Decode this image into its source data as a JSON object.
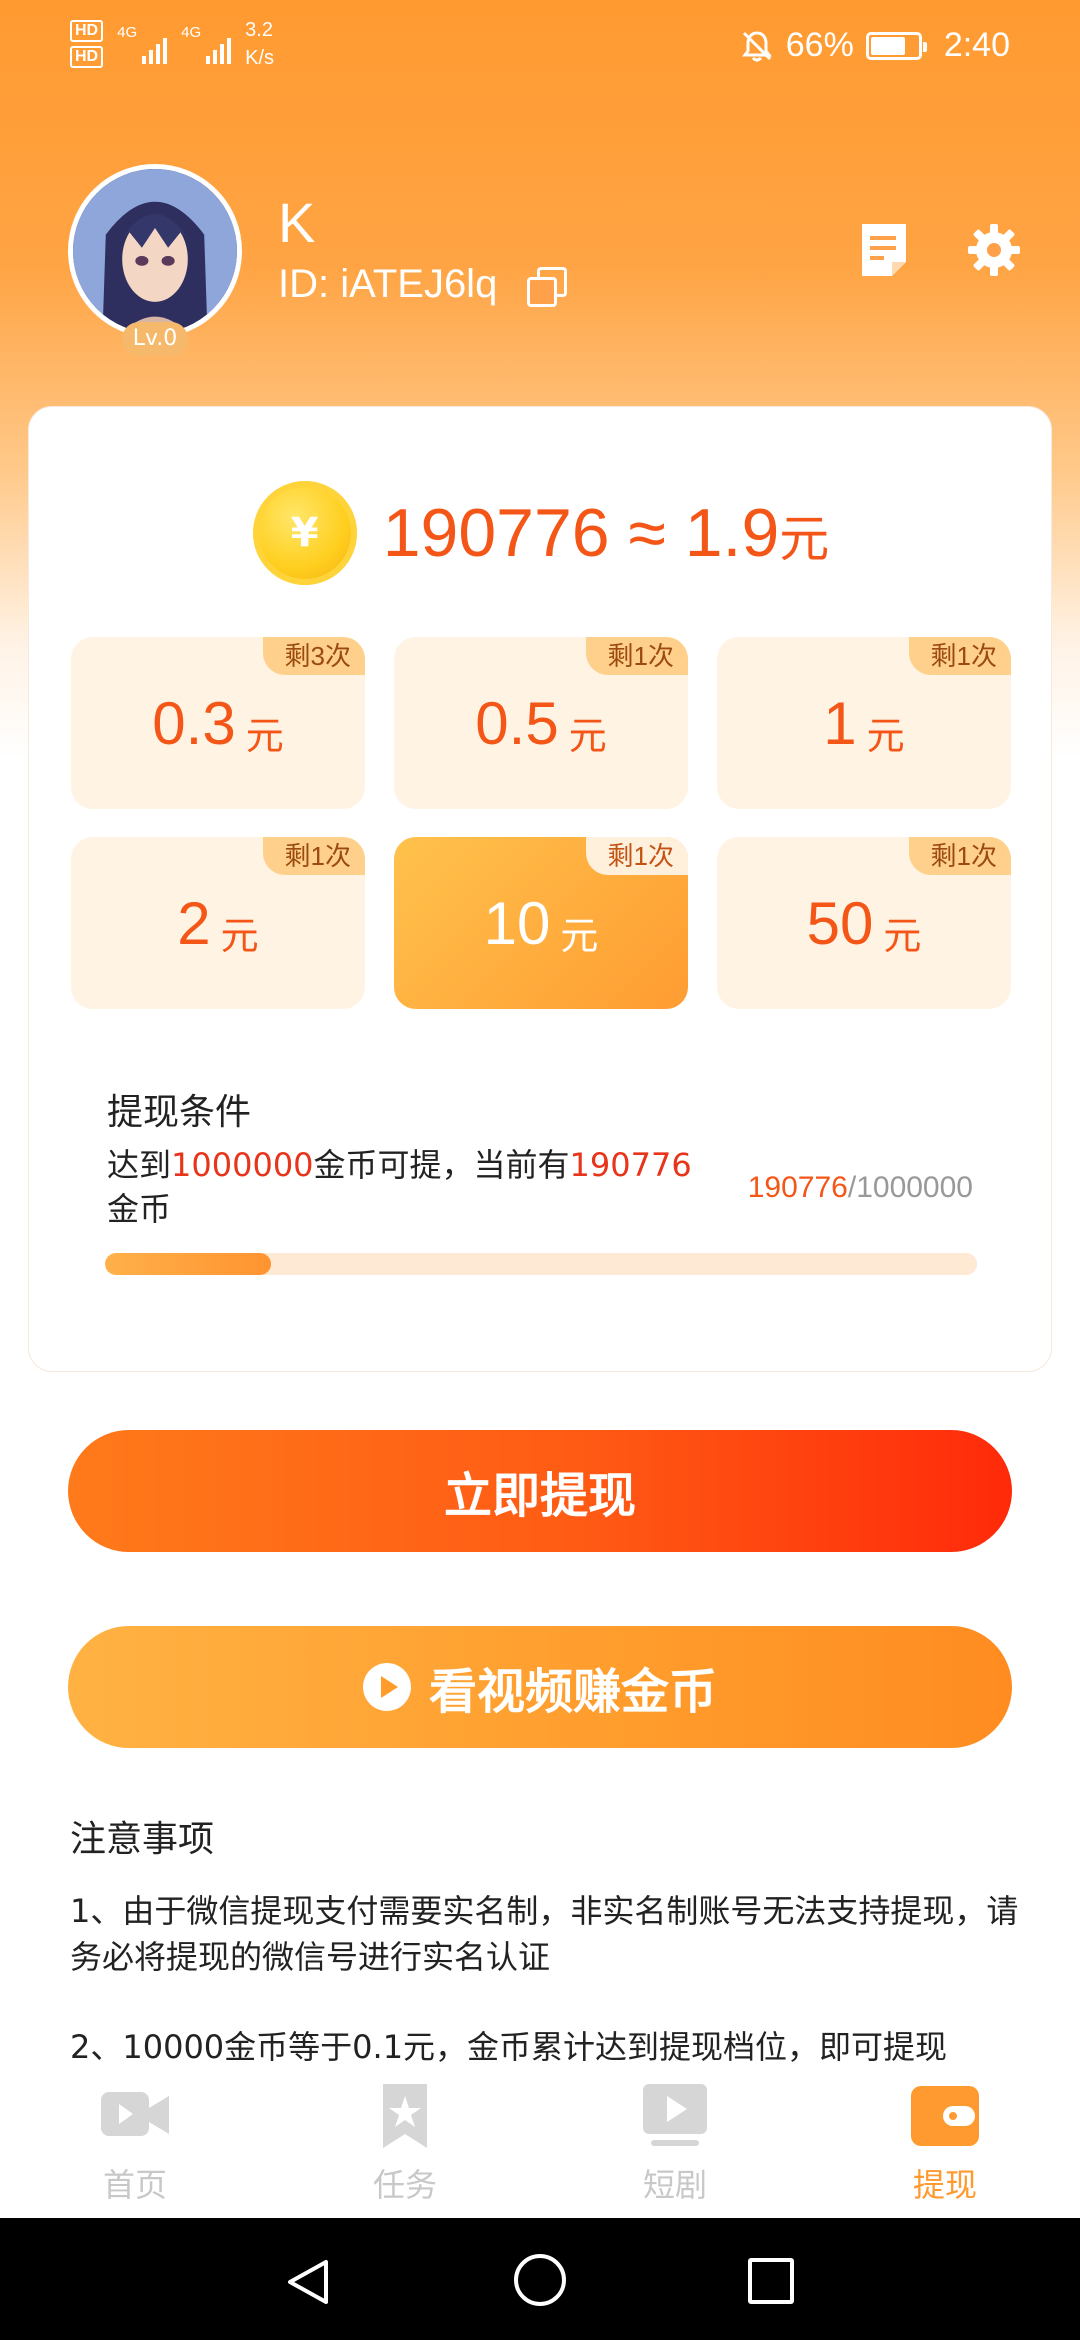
{
  "status_bar": {
    "hd1": "HD",
    "hd2": "HD",
    "net1": "4G",
    "net2": "4G",
    "speed_value": "3.2",
    "speed_unit": "K/s",
    "battery": "66%",
    "time": "2:40"
  },
  "profile": {
    "name": "K",
    "id_text": "ID: iATEJ6lq",
    "level": "Lv.0"
  },
  "balance": {
    "coin_symbol": "¥",
    "text": "190776 ≈ 1.9",
    "unit": "元"
  },
  "options": [
    {
      "amount": "0.3",
      "unit": "元",
      "remain": "剩3次"
    },
    {
      "amount": "0.5",
      "unit": "元",
      "remain": "剩1次"
    },
    {
      "amount": "1",
      "unit": "元",
      "remain": "剩1次"
    },
    {
      "amount": "2",
      "unit": "元",
      "remain": "剩1次"
    },
    {
      "amount": "10",
      "unit": "元",
      "remain": "剩1次"
    },
    {
      "amount": "50",
      "unit": "元",
      "remain": "剩1次"
    }
  ],
  "condition": {
    "title": "提现条件",
    "desc_prefix": "达到",
    "desc_target": "1000000",
    "desc_middle": "金币可提，当前有",
    "desc_current": "190776",
    "desc_suffix": "金币",
    "count_current": "190776",
    "count_total": "/1000000",
    "progress_fraction": 0.19
  },
  "buttons": {
    "withdraw": "立即提现",
    "watch_video": "看视频赚金币"
  },
  "notes": {
    "title": "注意事项",
    "item1": "1、由于微信提现支付需要实名制，非实名制账号无法支持提现，请务必将提现的微信号进行实名认证",
    "item2": "2、10000金币等于0.1元，金币累计达到提现档位，即可提现"
  },
  "tabs": [
    {
      "label": "首页",
      "icon": "video-camera-icon"
    },
    {
      "label": "任务",
      "icon": "bookmark-star-icon"
    },
    {
      "label": "短剧",
      "icon": "play-screen-icon"
    },
    {
      "label": "提现",
      "icon": "wallet-icon"
    }
  ],
  "colors": {
    "accent": "#ff9a30",
    "price": "#f35617",
    "highlight": "#e8341b"
  }
}
